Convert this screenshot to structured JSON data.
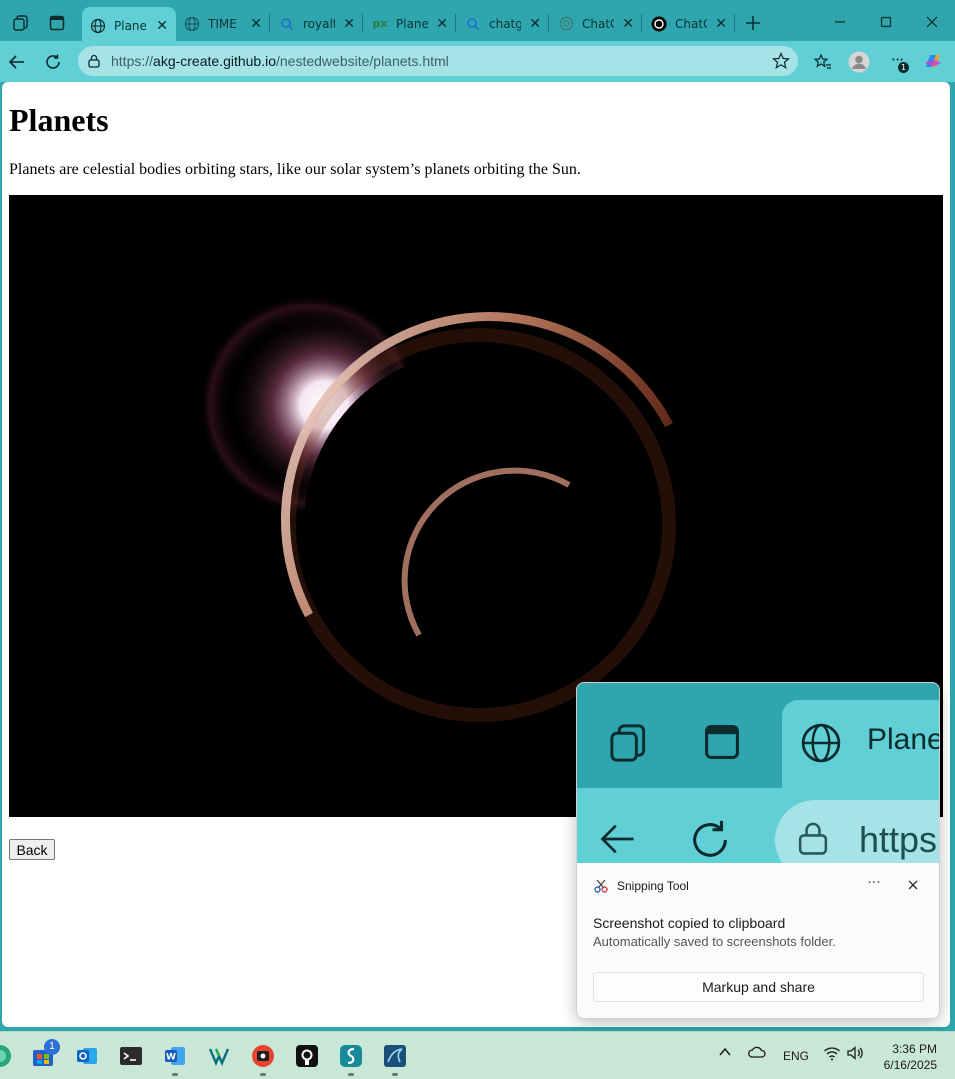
{
  "browser": {
    "tabs": [
      {
        "title": "Planets",
        "icon": "globe-icon",
        "active": true
      },
      {
        "title": "TIME Ear",
        "icon": "globe-icon",
        "active": false
      },
      {
        "title": "royalty",
        "icon": "search-icon",
        "active": false
      },
      {
        "title": "Planets",
        "icon": "pexels-icon",
        "active": false
      },
      {
        "title": "chatgpt",
        "icon": "search-icon",
        "active": false
      },
      {
        "title": "ChatGPT",
        "icon": "chatgpt-icon",
        "active": false
      },
      {
        "title": "ChatGPT",
        "icon": "openai-icon",
        "active": false
      }
    ],
    "url": {
      "scheme": "https://",
      "host": "akg-create.github.io",
      "path": "/nestedwebsite/planets.html"
    },
    "colors": {
      "frame": "#2fa6ad",
      "toolbar": "#61d0d6",
      "address": "#a6e3e6"
    }
  },
  "page": {
    "title": "Planets",
    "description": "Planets are celestial bodies orbiting stars, like our solar system’s planets orbiting the Sun.",
    "image_alt": "eclipse-planets-image",
    "back_label": "Back"
  },
  "toast": {
    "app_name": "Snipping Tool",
    "more_label": "···",
    "message": "Screenshot copied to clipboard",
    "detail": "Automatically saved to screenshots folder.",
    "action_label": "Markup and share",
    "preview": {
      "tab_title": "Plane",
      "url_fragment": "https"
    }
  },
  "taskbar": {
    "store_badge": "1",
    "tray": {
      "language": "ENG"
    },
    "clock": {
      "time": "3:36 PM",
      "date": "6/16/2025"
    }
  },
  "menu_badge": "1"
}
